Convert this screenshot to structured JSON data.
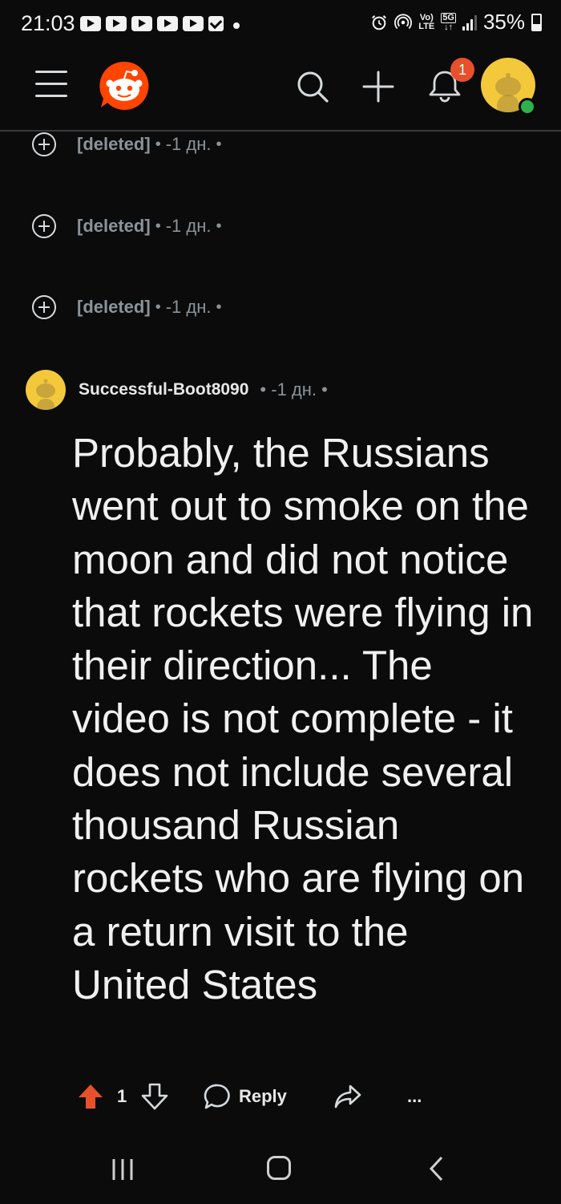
{
  "status_bar": {
    "time": "21:03",
    "network_top": "Vo)",
    "network_bottom": "LTE",
    "gen_label": "5G",
    "battery": "35%"
  },
  "header": {
    "notification_count": "1",
    "icons": [
      "menu-icon",
      "reddit-logo",
      "search-icon",
      "plus-icon",
      "bell-icon",
      "avatar"
    ]
  },
  "deleted_comments": [
    {
      "author": "[deleted]",
      "sep": "•",
      "time": "-1 дн.",
      "sep2": "•"
    },
    {
      "author": "[deleted]",
      "sep": "•",
      "time": "-1 дн.",
      "sep2": "•"
    },
    {
      "author": "[deleted]",
      "sep": "•",
      "time": "-1 дн.",
      "sep2": "•"
    }
  ],
  "comment": {
    "author": "Successful-Boot8090",
    "meta": "• -1 дн. •",
    "body": "Probably, the Russians went out to smoke on the moon and did not notice that rockets were flying in their direction... The video is not complete - it does not include several thousand Russian rockets who are flying on a return visit to the United States",
    "votes": "1",
    "reply_label": "Reply",
    "more_label": "..."
  },
  "colors": {
    "background": "#0b0b0c",
    "upvote_active": "#e8502c",
    "avatar_yellow": "#f3c93b",
    "meta_gray": "#8c9398"
  }
}
